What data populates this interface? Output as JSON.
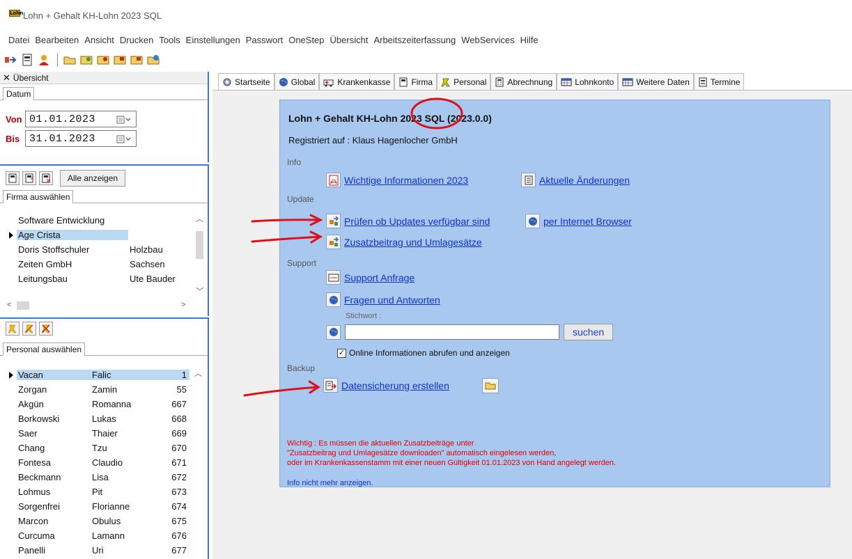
{
  "window": {
    "title": "Lohn + Gehalt KH-Lohn 2023 SQL",
    "logo_text": "Lohn"
  },
  "menu": [
    "Datei",
    "Bearbeiten",
    "Ansicht",
    "Drucken",
    "Tools",
    "Einstellungen",
    "Passwort",
    "OneStep",
    "Übersicht",
    "Arbeitszeiterfassung",
    "WebServices",
    "Hilfe"
  ],
  "overview_panel": {
    "header": "Übersicht",
    "tab": "Datum",
    "from_label": "Von",
    "from_value": "01.01.2023",
    "to_label": "Bis",
    "to_value": "31.01.2023"
  },
  "firm_panel": {
    "show_all_label": "Alle anzeigen",
    "tab": "Firma auswählen",
    "rows": [
      {
        "name": "Software Entwicklung",
        "extra": ""
      },
      {
        "name": "Age Crista",
        "extra": "",
        "selected": true
      },
      {
        "name": "Doris Stoffschuler",
        "extra": "Holzbau"
      },
      {
        "name": "Zeiten GmbH",
        "extra": "Sachsen"
      },
      {
        "name": "Leitungsbau",
        "extra": "Ute Bauder"
      }
    ]
  },
  "personal_panel": {
    "tab": "Personal auswählen",
    "rows": [
      {
        "last": "Vacan",
        "first": "Falic",
        "nr": "1",
        "selected": true
      },
      {
        "last": "Zorgan",
        "first": "Zamin",
        "nr": "55"
      },
      {
        "last": "Akgün",
        "first": "Romanna",
        "nr": "667"
      },
      {
        "last": "Borkowski",
        "first": "Lukas",
        "nr": "668"
      },
      {
        "last": "Saer",
        "first": "Thaier",
        "nr": "669"
      },
      {
        "last": "Chang",
        "first": "Tzu",
        "nr": "670"
      },
      {
        "last": "Fontesa",
        "first": "Claudio",
        "nr": "671"
      },
      {
        "last": "Beckmann",
        "first": "Lisa",
        "nr": "672"
      },
      {
        "last": "Lohmus",
        "first": "Pit",
        "nr": "673"
      },
      {
        "last": "Sorgenfrei",
        "first": "Florianne",
        "nr": "674"
      },
      {
        "last": "Marcon",
        "first": "Obulus",
        "nr": "675"
      },
      {
        "last": "Curcuma",
        "first": "Lamann",
        "nr": "676"
      },
      {
        "last": "Panelli",
        "first": "Uri",
        "nr": "677"
      }
    ]
  },
  "tabs": [
    "Startseite",
    "Global",
    "Krankenkasse",
    "Firma",
    "Personal",
    "Abrechnung",
    "Lohnkonto",
    "Weitere Daten",
    "Termine"
  ],
  "start": {
    "app_title": "Lohn + Gehalt KH-Lohn 2023 SQL (2023.0.0)",
    "registered": "Registriert auf : Klaus Hagenlocher GmbH",
    "sections": {
      "info": "Info",
      "update": "Update",
      "support": "Support",
      "backup": "Backup"
    },
    "links": {
      "wichtige_info": "Wichtige Informationen 2023",
      "aktuelle_aenderungen": "Aktuelle Änderungen",
      "pruefen_updates": "Prüfen ob Updates verfügbar sind",
      "per_browser": "per Internet Browser",
      "zusatzbeitrag": "Zusatzbeitrag und Umlagesätze",
      "support_anfrage": "Support Anfrage",
      "fragen_antworten": "Fragen und Antworten",
      "datensicherung": "Datensicherung erstellen"
    },
    "stichwort_label": "Stichwort :",
    "search_button": "suchen",
    "online_info_label": "Online Informationen abrufen und anzeigen",
    "warning_lines": [
      "Wichtig : Es müssen die aktuellen Zusatzbeiträge unter",
      "\"Zusatzbeitrag und Umlagesätze downloaden\" automatisch eingelesen werden,",
      "oder im Krankenkassenstamm mit einer neuen Gültigkeit 01.01.2023 von Hand angelegt werden."
    ],
    "info_not_show": "Info nicht mehr anzeigen."
  },
  "colors": {
    "accent_blue": "#3a78d4",
    "content_bg": "#a8c8ef",
    "annotation_red": "#e0101a",
    "link": "#1030c8"
  }
}
